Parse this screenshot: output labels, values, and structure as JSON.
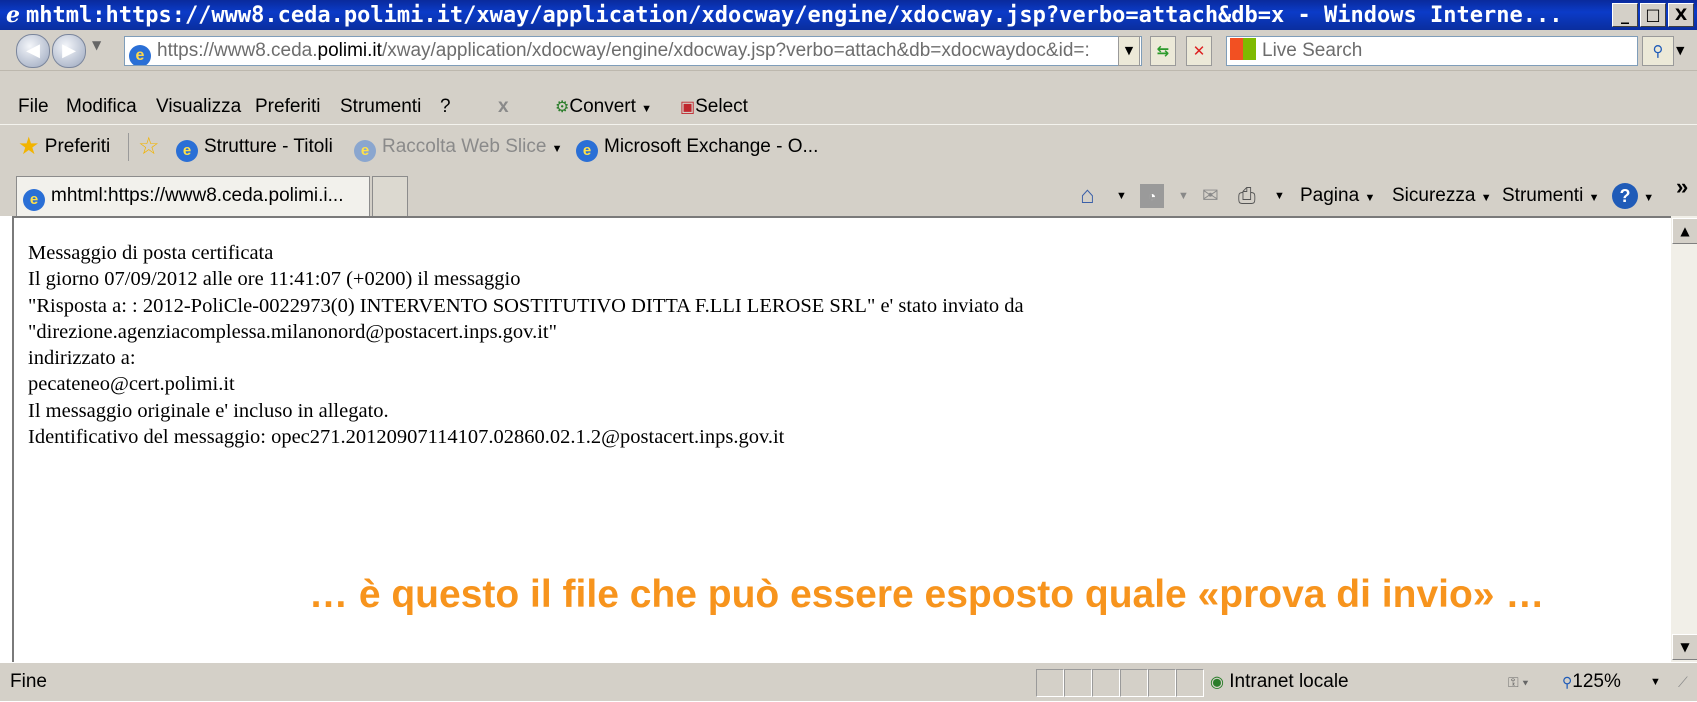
{
  "window": {
    "title": "mhtml:https://www8.ceda.polimi.it/xway/application/xdocway/engine/xdocway.jsp?verbo=attach&db=x - Windows Interne...",
    "minimize_label": "_",
    "maximize_label": "□",
    "close_label": "X"
  },
  "address_bar": {
    "url_prefix": "https://www8.ceda.",
    "url_domain": "polimi.it",
    "url_path": "/xway/application/xdocway/engine/xdocway.jsp?verbo=attach&db=xdocwaydoc&id=:"
  },
  "search": {
    "placeholder": "Live Search"
  },
  "menu": {
    "items": [
      "File",
      "Modifica",
      "Visualizza",
      "Preferiti",
      "Strumenti",
      "?"
    ],
    "close_label": "x",
    "convert_label": "Convert",
    "select_label": "Select"
  },
  "favorites": {
    "label": "Preferiti",
    "items": [
      "Strutture - Titoli",
      "Raccolta Web Slice",
      "Microsoft Exchange - O..."
    ]
  },
  "tabs": {
    "active_label": "mhtml:https://www8.ceda.polimi.i..."
  },
  "command_bar": {
    "pagina": "Pagina",
    "sicurezza": "Sicurezza",
    "strumenti": "Strumenti",
    "more": "»"
  },
  "message": {
    "lines": [
      "Messaggio di posta certificata",
      "Il giorno 07/09/2012 alle ore 11:41:07 (+0200) il messaggio",
      "\"Risposta a: : 2012-PoliCle-0022973(0) INTERVENTO SOSTITUTIVO DITTA F.LLI LEROSE SRL\" e' stato inviato da",
      "\"direzione.agenziacomplessa.milanonord@postacert.inps.gov.it\"",
      "indirizzato a:",
      "pecateneo@cert.polimi.it",
      "Il messaggio originale e' incluso in allegato.",
      "Identificativo del messaggio: opec271.20120907114107.02860.02.1.2@postacert.inps.gov.it"
    ]
  },
  "annotation": {
    "text": "… è questo il file che può essere esposto quale «prova di invio»  …",
    "color": "#f7941d"
  },
  "status_bar": {
    "status": "Fine",
    "zone": "Intranet locale",
    "zoom": "125%"
  }
}
